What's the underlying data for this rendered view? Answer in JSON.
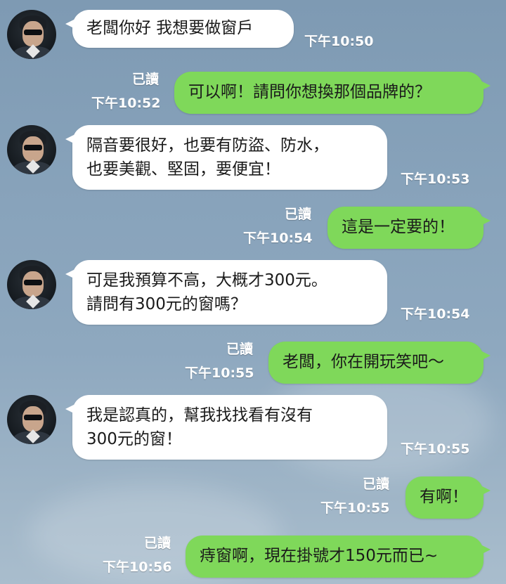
{
  "messages": [
    {
      "side": "in",
      "lines": [
        "老闆你好 我想要做窗戶"
      ],
      "time": "下午10:50"
    },
    {
      "side": "out",
      "lines": [
        "可以啊！請問你想換那個品牌的？"
      ],
      "read": "已讀",
      "time": "下午10:52"
    },
    {
      "side": "in",
      "lines": [
        "隔音要很好，也要有防盜、防水，",
        "也要美觀、堅固，要便宜！"
      ],
      "time": "下午10:53"
    },
    {
      "side": "out",
      "lines": [
        "這是一定要的！"
      ],
      "read": "已讀",
      "time": "下午10:54"
    },
    {
      "side": "in",
      "lines": [
        "可是我預算不高，大概才300元。",
        "請問有300元的窗嗎？"
      ],
      "time": "下午10:54"
    },
    {
      "side": "out",
      "lines": [
        "老闆，你在開玩笑吧～"
      ],
      "read": "已讀",
      "time": "下午10:55"
    },
    {
      "side": "in",
      "lines": [
        "我是認真的，幫我找找看有沒有",
        "300元的窗！"
      ],
      "time": "下午10:55"
    },
    {
      "side": "out",
      "lines": [
        "有啊！"
      ],
      "read": "已讀",
      "time": "下午10:55"
    },
    {
      "side": "out",
      "lines": [
        "痔窗啊，現在掛號才150元而已~"
      ],
      "read": "已讀",
      "time": "下午10:56"
    }
  ],
  "colors": {
    "outgoing": "#7fd85a",
    "incoming": "#ffffff",
    "background": "#88a3bb"
  },
  "icons": {
    "contact_avatar": "avatar-photo"
  }
}
